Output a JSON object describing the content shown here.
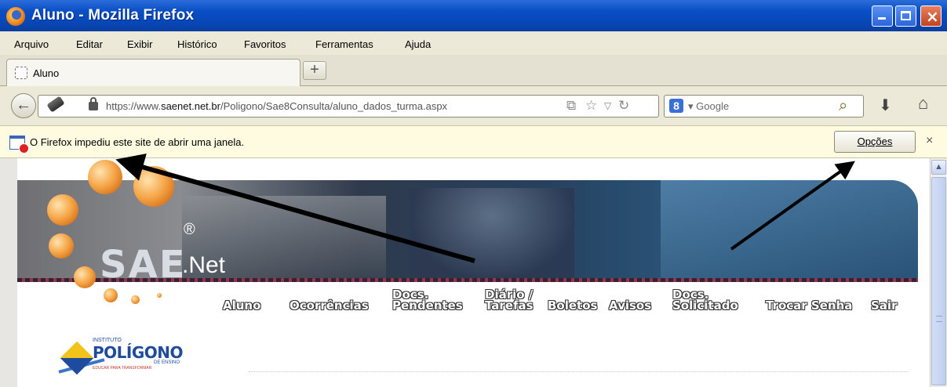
{
  "window": {
    "title": "Aluno - Mozilla Firefox"
  },
  "menu": {
    "items": [
      "Arquivo",
      "Editar",
      "Exibir",
      "Histórico",
      "Favoritos",
      "Ferramentas",
      "Ajuda"
    ]
  },
  "tabs": [
    {
      "label": "Aluno"
    }
  ],
  "newtab": {
    "label": "+"
  },
  "address": {
    "prefix": "https://www.",
    "domain": "saenet.net.br",
    "path": "/Poligono/Sae8Consulta/aluno_dados_turma.aspx"
  },
  "search": {
    "engine": "Google",
    "engine_icon": "8"
  },
  "notification": {
    "text": "O Firefox impediu este site de abrir uma janela.",
    "options_label": "Opções",
    "close_label": "×"
  },
  "site": {
    "logo_text": "SAE",
    "logo_net": ".Net",
    "logo_reg": "®",
    "nav": [
      {
        "line1": "",
        "line2": "Aluno"
      },
      {
        "line1": "",
        "line2": "Ocorrências"
      },
      {
        "line1": "Docs.",
        "line2": "Pendentes"
      },
      {
        "line1": "Diário /",
        "line2": "Tarefas"
      },
      {
        "line1": "",
        "line2": "Boletos"
      },
      {
        "line1": "",
        "line2": "Avisos"
      },
      {
        "line1": "Docs.",
        "line2": "Solicitado"
      },
      {
        "line1": "",
        "line2": "Trocar Senha"
      },
      {
        "line1": "",
        "line2": "Sair"
      }
    ],
    "poligono": {
      "inst": "INSTITUTO",
      "name": "POLÍGONO",
      "sub": "DE ENSINO",
      "tag": "EDUCAR PARA TRANSFORMAR"
    }
  },
  "colors": {
    "titlebar": "#0a4fc6",
    "notify_bg": "#fffbe1",
    "annotation_arrow": "#000000"
  }
}
